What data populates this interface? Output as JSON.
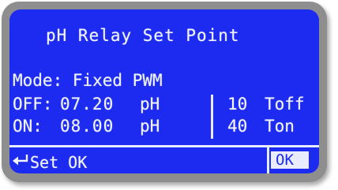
{
  "screen": {
    "title": "pH Relay Set Point",
    "mode": "Mode: Fixed PWM",
    "off": {
      "label": "OFF:",
      "value": "07.20",
      "unit": "pH",
      "time_value": "10",
      "time_label": "Toff"
    },
    "on": {
      "label": "ON:",
      "value": "08.00",
      "unit": "pH",
      "time_value": "40",
      "time_label": "Ton"
    },
    "footer": {
      "enter_icon": "enter-return-icon",
      "set_label": "Set OK",
      "ok_button": "OK"
    }
  },
  "colors": {
    "screen_background": "#1d2bf0",
    "text": "#f2f4ff",
    "bezel": "#8e8e8e"
  }
}
